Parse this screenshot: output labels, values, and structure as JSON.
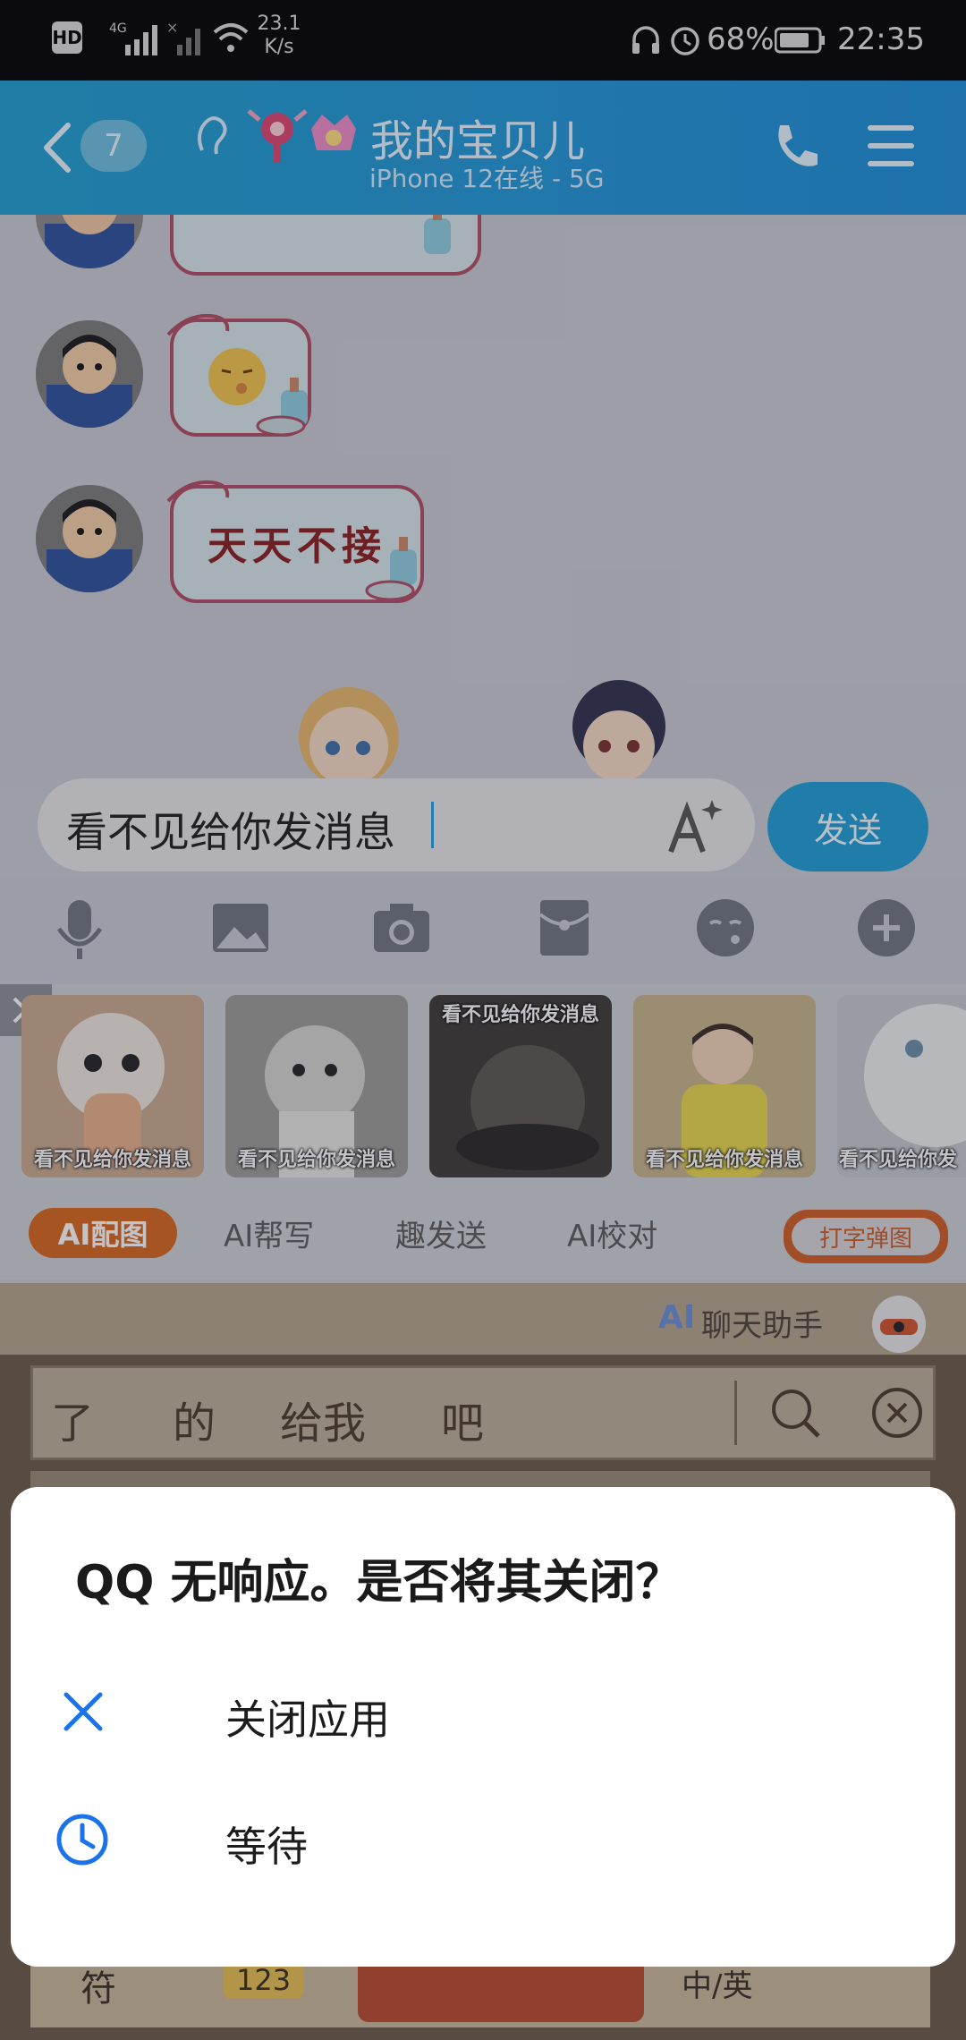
{
  "status_bar": {
    "left_icons": [
      "hd-icon",
      "signal-4g-icon",
      "signal-x-icon",
      "wifi-icon"
    ],
    "speed": "23.1",
    "speed_unit": "K/s",
    "battery": "68%",
    "time": "22:35"
  },
  "titlebar": {
    "unread_count": "7",
    "title": "我的宝贝儿",
    "subtitle": "iPhone 12在线 - 5G"
  },
  "chat": {
    "stickers": [
      {
        "kind": "partial"
      },
      {
        "kind": "emoji"
      },
      {
        "text": "天天不接"
      }
    ]
  },
  "input": {
    "value": "看不见给你发消息",
    "send_label": "发送"
  },
  "toolbar": {
    "icons": [
      "microphone-icon",
      "image-icon",
      "camera-icon",
      "red-packet-icon",
      "emoji-icon",
      "plus-icon"
    ]
  },
  "suggestions": {
    "thumbs": [
      {
        "caption": "看不见给你发消息",
        "bg": "#c9a98c"
      },
      {
        "caption": "看不见给你发消息",
        "bg": "#9c9c98"
      },
      {
        "caption": "看不见给你发消息",
        "bg": "#4a4440"
      },
      {
        "caption": "看不见给你发消息",
        "bg": "#c8b48a"
      },
      {
        "caption": "看不见给你发",
        "bg": "#c5c9cc"
      }
    ],
    "top_caption": "看不见给你发消息",
    "chips": {
      "active": "AI配图",
      "items": [
        "AI帮写",
        "趣发送",
        "AI校对"
      ],
      "outline": "打字弹图"
    }
  },
  "ai_helper": {
    "ai_mark": "AI",
    "label": "聊天助手"
  },
  "keyboard": {
    "candidates": [
      "了",
      "的",
      "给我",
      "吧"
    ],
    "bottom_left": "符",
    "bottom_num": "123",
    "bottom_right": "中/英"
  },
  "dialog": {
    "title": "QQ 无响应。是否将其关闭？",
    "close_label": "关闭应用",
    "wait_label": "等待"
  },
  "colors": {
    "accent": "#1f9fd7",
    "dialog_icon": "#1a73e8",
    "chip_orange": "#d9661c"
  }
}
